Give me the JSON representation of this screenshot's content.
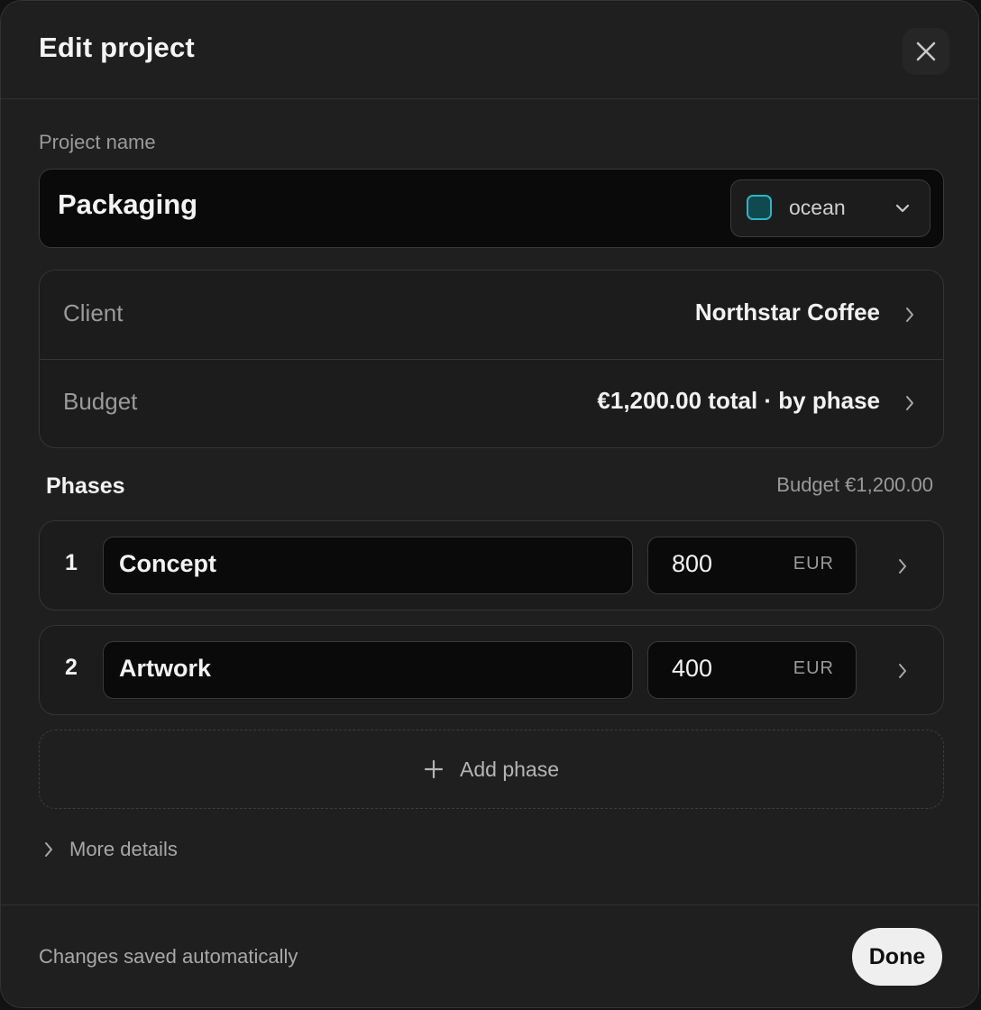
{
  "dialog": {
    "title": "Edit project"
  },
  "project_name": {
    "label": "Project name",
    "value": "Packaging"
  },
  "color_select": {
    "selected": "ocean",
    "swatch_color": "#0f4a4f",
    "swatch_border": "#2fb4c4"
  },
  "info_rows": [
    {
      "label": "Client",
      "value": "Northstar Coffee"
    },
    {
      "label": "Budget",
      "value": "€1,200.00 total · by phase"
    }
  ],
  "phases": {
    "title": "Phases",
    "budget_summary": "Budget €1,200.00",
    "items": [
      {
        "number": "1",
        "name": "Concept",
        "amount": "800",
        "currency": "EUR"
      },
      {
        "number": "2",
        "name": "Artwork",
        "amount": "400",
        "currency": "EUR"
      }
    ],
    "add_label": "Add phase"
  },
  "more_details": {
    "label": "More details"
  },
  "footer": {
    "status": "Changes saved automatically",
    "done_label": "Done"
  },
  "colors": {
    "background": "#1f1f1f",
    "input_background": "#0a0a0a",
    "accent": "#2fb4c4",
    "button": "#efefef"
  },
  "icons": {
    "close": "close-icon",
    "dropdown": "chevron-down-icon",
    "row_chevron": "chevron-right-icon",
    "add": "plus-icon"
  }
}
